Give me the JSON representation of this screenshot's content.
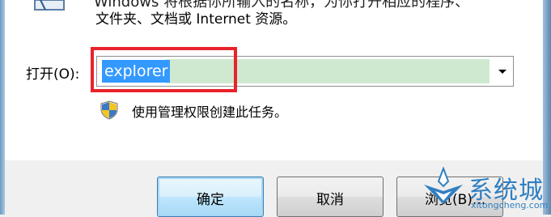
{
  "dialog": {
    "description_line1": "Windows 将根据你所输入的名称，为你打开相应的程序、",
    "description_line2": "文件夹、文档或 Internet 资源。",
    "open_label": "打开(O):",
    "open_value": "explorer",
    "admin_note": "使用管理权限创建此任务。"
  },
  "buttons": {
    "ok": "确定",
    "cancel": "取消",
    "browse": "浏览(B)..."
  },
  "watermark": {
    "text": "系统城",
    "url": "xitongcheng.com"
  },
  "colors": {
    "highlight": "#e8232b",
    "selection": "#3399ff",
    "input_fill": "#cfe9d0",
    "watermark": "#2f7fc1"
  }
}
